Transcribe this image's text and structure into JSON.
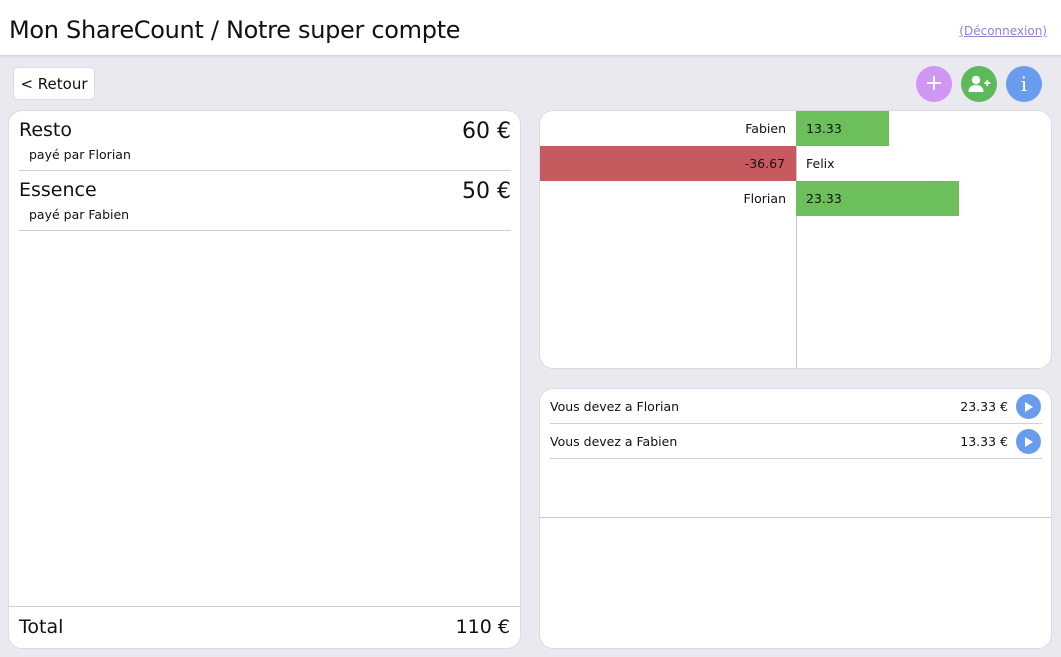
{
  "header": {
    "title": "Mon ShareCount / Notre super compte",
    "logout_label": "(Déconnexion)"
  },
  "toolbar": {
    "back_label": "< Retour",
    "add_label": "+",
    "info_label": "i",
    "colors": {
      "add": "#cf97f3",
      "add_user": "#5cba5c",
      "info": "#6a9cee"
    }
  },
  "expenses": {
    "items": [
      {
        "name": "Resto",
        "amount": "60 €",
        "payer": "payé par Florian"
      },
      {
        "name": "Essence",
        "amount": "50 €",
        "payer": "payé par Fabien"
      }
    ],
    "total_label": "Total",
    "total_value": "110 €"
  },
  "balances": {
    "max_abs": 36.67,
    "colors": {
      "positive": "#6cbf5b",
      "negative": "#c65a5f"
    },
    "items": [
      {
        "name": "Fabien",
        "value": 13.33,
        "label": "13.33"
      },
      {
        "name": "Felix",
        "value": -36.67,
        "label": "-36.67"
      },
      {
        "name": "Florian",
        "value": 23.33,
        "label": "23.33"
      }
    ]
  },
  "debts": {
    "items": [
      {
        "label": "Vous devez a Florian",
        "amount": "23.33 €"
      },
      {
        "label": "Vous devez a Fabien",
        "amount": "13.33 €"
      }
    ]
  }
}
